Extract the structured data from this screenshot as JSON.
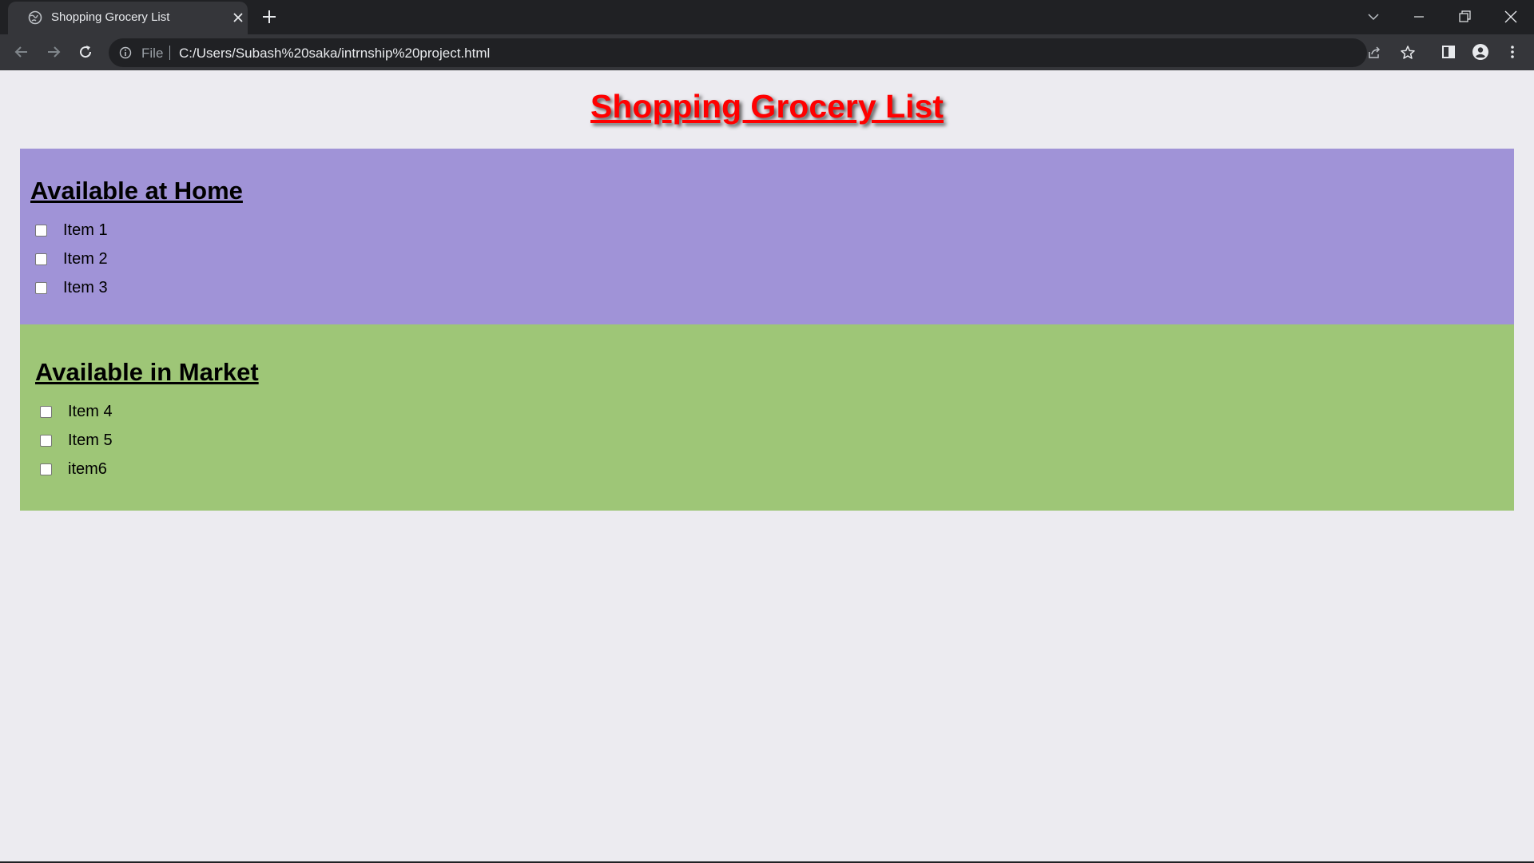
{
  "browser": {
    "tab_title": "Shopping Grocery List",
    "omnibox": {
      "scheme": "File",
      "url": "C:/Users/Subash%20saka/intrnship%20project.html"
    },
    "icons": [
      "globe-icon",
      "close-icon",
      "plus-icon",
      "chevron-down-icon",
      "minimize-icon",
      "restore-icon",
      "close-window-icon",
      "back-arrow-icon",
      "forward-arrow-icon",
      "reload-icon",
      "info-icon",
      "share-icon",
      "star-icon",
      "side-panel-icon",
      "profile-icon",
      "kebab-menu-icon"
    ]
  },
  "page": {
    "title": "Shopping Grocery List",
    "title_color": "#ff0000",
    "sections": [
      {
        "heading": "Available at Home",
        "color": "#a093d7",
        "items": [
          {
            "label": "Item 1",
            "checked": false
          },
          {
            "label": "Item 2",
            "checked": false
          },
          {
            "label": "Item 3",
            "checked": false
          }
        ]
      },
      {
        "heading": "Available in Market",
        "color": "#9ec677",
        "items": [
          {
            "label": "Item 4",
            "checked": false
          },
          {
            "label": "Item 5",
            "checked": false
          },
          {
            "label": "item6",
            "checked": false
          }
        ]
      }
    ]
  }
}
